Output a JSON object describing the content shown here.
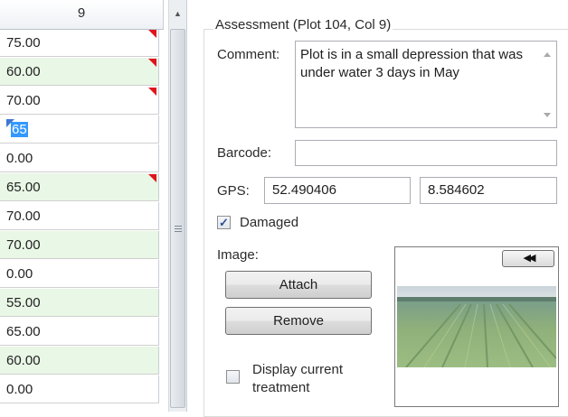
{
  "grid": {
    "column_header": "9",
    "rows": [
      {
        "value": "75.00",
        "flag": true
      },
      {
        "value": "60.00",
        "flag": true
      },
      {
        "value": "70.00",
        "flag": true
      },
      {
        "value": "65",
        "editing": true
      },
      {
        "value": "0.00",
        "flag": false
      },
      {
        "value": "65.00",
        "flag": true
      },
      {
        "value": "70.00",
        "flag": false
      },
      {
        "value": "70.00",
        "flag": false
      },
      {
        "value": "0.00",
        "flag": false
      },
      {
        "value": "55.00",
        "flag": false
      },
      {
        "value": "65.00",
        "flag": false
      },
      {
        "value": "60.00",
        "flag": false
      },
      {
        "value": "0.00",
        "flag": false
      }
    ]
  },
  "assessment": {
    "group_title": "Assessment (Plot  104, Col  9)",
    "comment_label": "Comment:",
    "comment_text": "Plot is in a small depression that was under water 3 days in May",
    "barcode_label": "Barcode:",
    "barcode_value": "",
    "gps_label": "GPS:",
    "gps_lat": "52.490406",
    "gps_lon": "8.584602",
    "damaged_label": "Damaged",
    "damaged_checked": true,
    "image_label": "Image:",
    "attach_label": "Attach",
    "remove_label": "Remove",
    "display_treatment_label_1": "Display current",
    "display_treatment_label_2": "treatment",
    "display_treatment_checked": false
  },
  "colors": {
    "alt_row": "#e9f7e6",
    "flag": "#e0141c",
    "selection": "#3399ff"
  }
}
